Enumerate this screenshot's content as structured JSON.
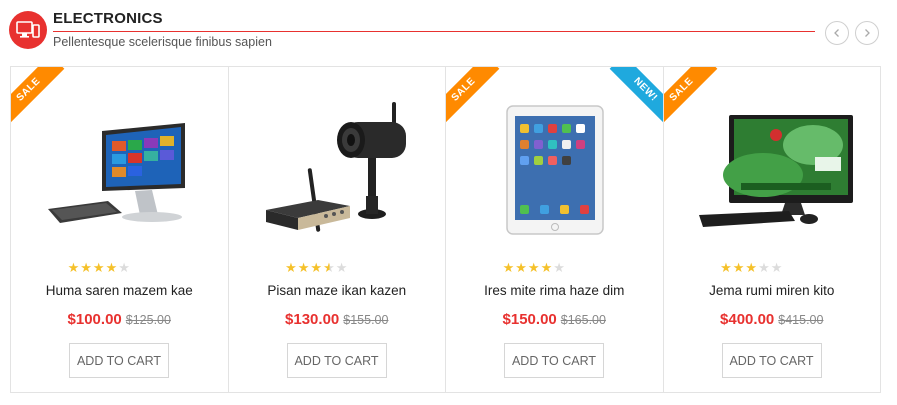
{
  "category": {
    "title": "ELECTRONICS",
    "subtitle": "Pellentesque scelerisque finibus sapien",
    "icon": "monitor-phone-icon",
    "accent_color": "#e8312f"
  },
  "nav": {
    "prev_icon": "chevron-left-icon",
    "next_icon": "chevron-right-icon"
  },
  "colors": {
    "sale": "#ff8a00",
    "new": "#1fa9de",
    "price": "#e8312f",
    "star": "#f5c12a"
  },
  "products": [
    {
      "name": "Huma saren mazem kae",
      "price": "$100.00",
      "old_price": "$125.00",
      "rating": 4,
      "rating_max": 5,
      "badges": [
        "SALE"
      ],
      "image": "all-in-one-pc-with-keyboard-image",
      "cart_label": "ADD TO CART"
    },
    {
      "name": "Pisan maze ikan kazen",
      "price": "$130.00",
      "old_price": "$155.00",
      "rating": 3.5,
      "rating_max": 5,
      "badges": [],
      "image": "security-camera-and-receiver-image",
      "cart_label": "ADD TO CART"
    },
    {
      "name": "Ires mite rima haze dim",
      "price": "$150.00",
      "old_price": "$165.00",
      "rating": 4,
      "rating_max": 5,
      "badges": [
        "SALE",
        "NEW!"
      ],
      "image": "tablet-image",
      "cart_label": "ADD TO CART"
    },
    {
      "name": "Jema rumi miren kito",
      "price": "$400.00",
      "old_price": "$415.00",
      "rating": 3,
      "rating_max": 5,
      "badges": [
        "SALE"
      ],
      "image": "monitor-with-keyboard-image",
      "cart_label": "ADD TO CART"
    }
  ]
}
